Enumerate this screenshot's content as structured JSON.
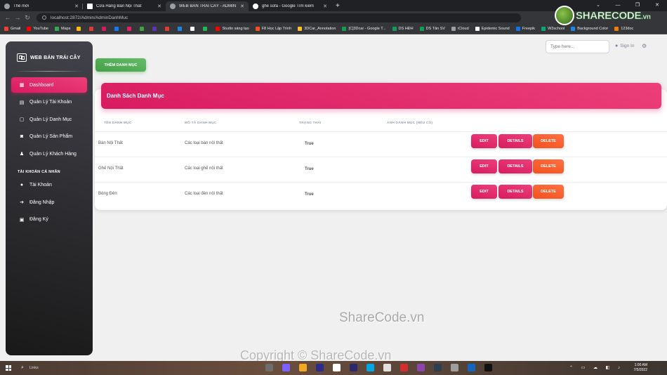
{
  "browser": {
    "tabs": [
      {
        "label": "Thẻ mới",
        "active": false
      },
      {
        "label": "Cửa Hàng Bàn Nội Thất",
        "active": false
      },
      {
        "label": "WEB BÁN TRÁI CÂY - ADMIN",
        "active": true
      },
      {
        "label": "ghế sofa - Google Tìm kiếm",
        "active": false
      }
    ],
    "new_tab": "+",
    "url": "localhost:2872/Admin/AdminDanhMuc",
    "bookmarks": [
      {
        "label": "Gmail",
        "color": "#ea4335"
      },
      {
        "label": "YouTube",
        "color": "#ff0000"
      },
      {
        "label": "Maps",
        "color": "#34a853"
      },
      {
        "label": "",
        "color": "#fbbc04"
      },
      {
        "label": "",
        "color": "#e53935"
      },
      {
        "label": "",
        "color": "#d81b60"
      },
      {
        "label": "",
        "color": "#1877f2"
      },
      {
        "label": "",
        "color": "#e91e63"
      },
      {
        "label": "",
        "color": "#43a047"
      },
      {
        "label": "",
        "color": "#5e35b1"
      },
      {
        "label": "",
        "color": "#e53935"
      },
      {
        "label": "",
        "color": "#1e88e5"
      },
      {
        "label": "",
        "color": "#ffffff"
      },
      {
        "label": "",
        "color": "#1db954"
      },
      {
        "label": "Studio sáng tạo",
        "color": "#ff0000"
      },
      {
        "label": "F8 Học Lập Trình",
        "color": "#f4511e"
      },
      {
        "label": "3DCar_Annotation",
        "color": "#fbc02d"
      },
      {
        "label": "[C]3Dcar - Google T...",
        "color": "#0f9d58"
      },
      {
        "label": "DS HĐH",
        "color": "#0f9d58"
      },
      {
        "label": "DS Tân SV",
        "color": "#0f9d58"
      },
      {
        "label": "iCloud",
        "color": "#9e9e9e"
      },
      {
        "label": "Epidemic Sound",
        "color": "#ffffff"
      },
      {
        "label": "Freepik",
        "color": "#1273eb"
      },
      {
        "label": "W3school",
        "color": "#04aa6d"
      },
      {
        "label": "Background Color",
        "color": "#1e88e5"
      },
      {
        "label": "123doc",
        "color": "#f57c00"
      }
    ]
  },
  "sidebar": {
    "brand": "WEB BÁN TRÁI CÂY",
    "items": [
      {
        "label": "Dashboard",
        "icon": "dashboard-icon",
        "glyph": "▦",
        "active": true
      },
      {
        "label": "Quản Lý Tài Khoản",
        "icon": "accounts-icon",
        "glyph": "▤",
        "active": false
      },
      {
        "label": "Quản Lý Danh Mục",
        "icon": "category-icon",
        "glyph": "▢",
        "active": false
      },
      {
        "label": "Quản Lý Sản Phẩm",
        "icon": "product-icon",
        "glyph": "◙",
        "active": false
      },
      {
        "label": "Quản Lý Khách Hàng",
        "icon": "customer-icon",
        "glyph": "♟",
        "active": false
      }
    ],
    "section_label": "TÀI KHOẢN CÁ NHÂN",
    "personal": [
      {
        "label": "Tài Khoản",
        "icon": "person-icon",
        "glyph": "●"
      },
      {
        "label": "Đăng Nhập",
        "icon": "login-icon",
        "glyph": "➔"
      },
      {
        "label": "Đăng Ký",
        "icon": "register-icon",
        "glyph": "▣"
      }
    ]
  },
  "topbar": {
    "search_placeholder": "Type here...",
    "signin_label": "Sign In"
  },
  "main": {
    "add_button": "THÊM DANH MỤC",
    "card_title": "Danh Sách Danh Mục",
    "columns": [
      "TÊN DANH MỤC",
      "MÔ TẢ DANH MỤC",
      "TRẠNG THÁI",
      "ẢNH DANH MỤC (NẾU CÓ)"
    ],
    "rows": [
      {
        "name": "Bàn Nội Thất",
        "description": "Các loại bàn nội thất",
        "status": "True"
      },
      {
        "name": "Ghế Nội Thất",
        "description": "Các loại ghế nội thất",
        "status": "True"
      },
      {
        "name": "Bóng Đèn",
        "description": "Các loại đèn nội thất",
        "status": "True"
      }
    ],
    "actions": {
      "edit": "EDIT",
      "details": "DETAILS",
      "delete": "DELETE"
    }
  },
  "watermarks": {
    "logo_main": "SHARECODE",
    "logo_suffix": ".vn",
    "center": "ShareCode.vn",
    "copyright": "Copyright © ShareCode.vn"
  },
  "taskbar": {
    "search_label": "Links",
    "time": "1:00 AM",
    "date": "7/5/2022",
    "app_colors": [
      "#6d6d6d",
      "#7b61ff",
      "#f5a623",
      "#2c2c8c",
      "#ffffff",
      "#2b2b6b",
      "#00a8e8",
      "#e0e0e0",
      "#d32f2f",
      "#8e44ad",
      "#2c3e50",
      "#9e9e9e",
      "#1565c0",
      "#111111"
    ]
  },
  "colors": {
    "accent_pink": "#e91e63",
    "add_green": "#4caf50",
    "delete_orange": "#f4511e"
  }
}
